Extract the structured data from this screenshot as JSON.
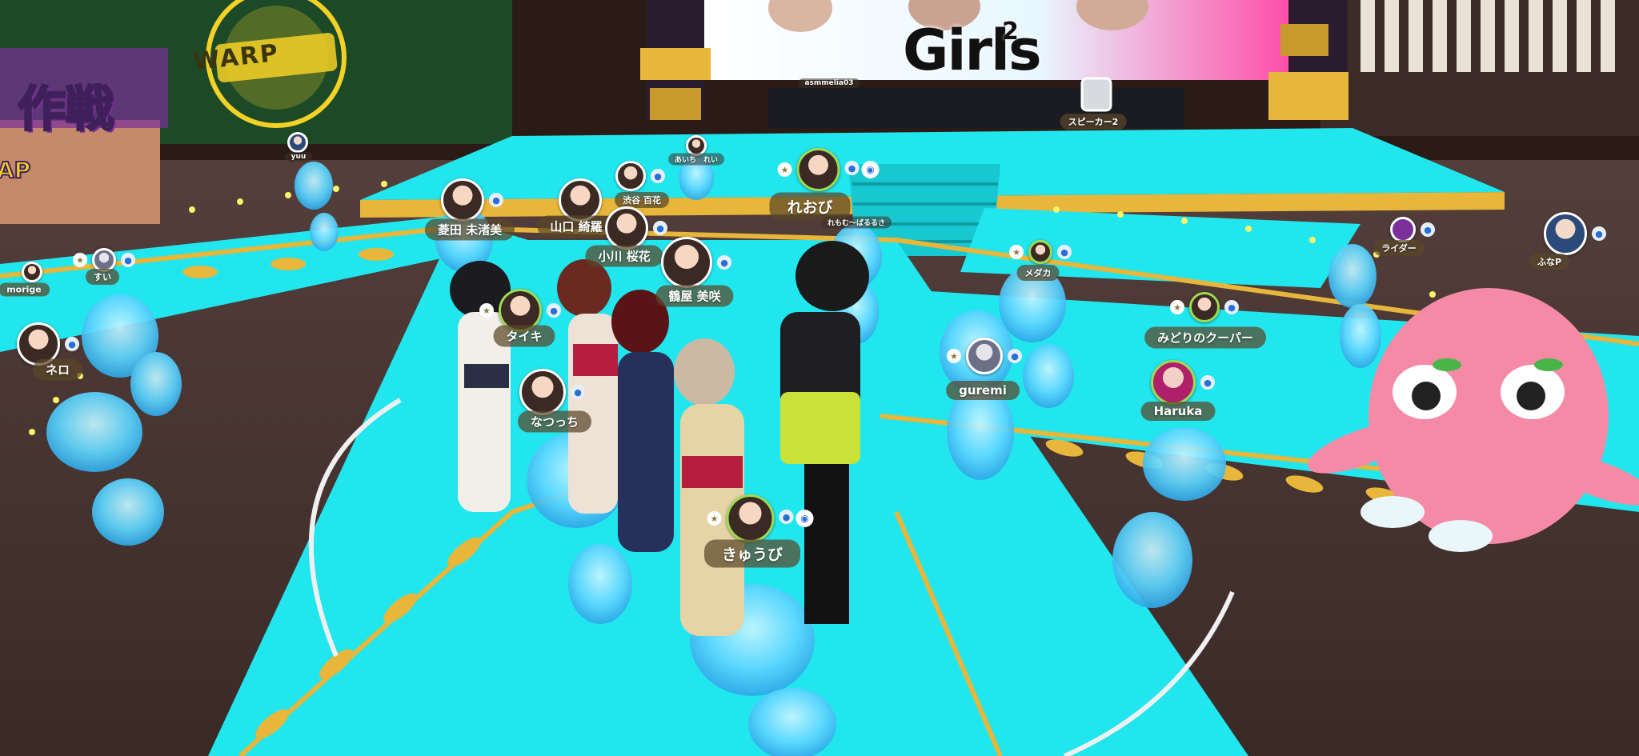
{
  "banner": {
    "title": "Girls",
    "superscript": "2",
    "host_label": "asmmelia03"
  },
  "warp_sign": {
    "label": "WARP"
  },
  "left_sign": {
    "big_text": "作戦",
    "small_text": "AP"
  },
  "speaker": {
    "label": "スピーカー2"
  },
  "players": [
    {
      "id": "yuu",
      "name": "yuu"
    },
    {
      "id": "aichi",
      "name": "あいち　れい"
    },
    {
      "id": "reobi",
      "name": "れおび"
    },
    {
      "id": "ritanbasa",
      "name": "れもむ〜ばるるさ"
    },
    {
      "id": "hishida",
      "name": "菱田 未渚美"
    },
    {
      "id": "shibuya",
      "name": "渋谷 百花"
    },
    {
      "id": "yamaguchi",
      "name": "山口 綺羅"
    },
    {
      "id": "ogawa",
      "name": "小川 桜花"
    },
    {
      "id": "tsuruya",
      "name": "鶴屋 美咲"
    },
    {
      "id": "morige",
      "name": "morige"
    },
    {
      "id": "sui",
      "name": "すい"
    },
    {
      "id": "neko",
      "name": "ネロ"
    },
    {
      "id": "taiki",
      "name": "タイキ"
    },
    {
      "id": "natsucchi",
      "name": "なつっち"
    },
    {
      "id": "kyuubi",
      "name": "きゅうび"
    },
    {
      "id": "medaka",
      "name": "メダカ"
    },
    {
      "id": "midori",
      "name": "みどりのクーパー"
    },
    {
      "id": "guremi",
      "name": "guremi"
    },
    {
      "id": "haruka",
      "name": "Haruka"
    },
    {
      "id": "raider",
      "name": "ライダー"
    },
    {
      "id": "funap",
      "name": "ふなP"
    }
  ],
  "colors": {
    "stage_cyan": "#22e6ee",
    "stage_gold": "#e7b63a",
    "floor_brown": "#4a3530",
    "ghost_blue": "#5fd6ff",
    "octopus_pink": "#f48aa6"
  }
}
